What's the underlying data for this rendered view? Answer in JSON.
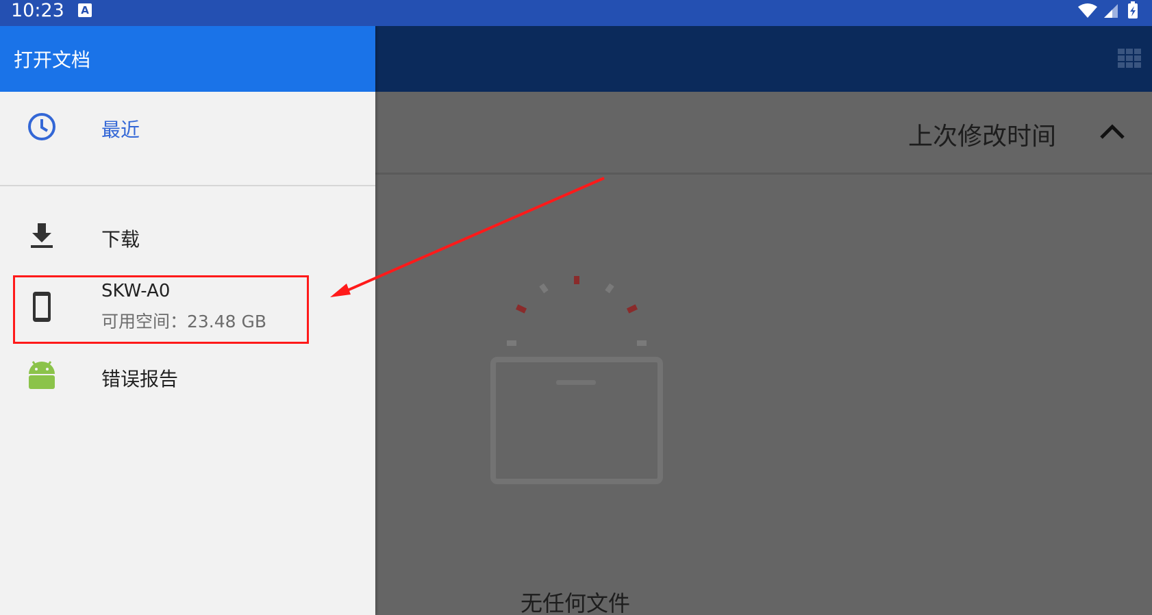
{
  "status_bar": {
    "time": "10:23",
    "notification_icon": "A",
    "icons": [
      "wifi-icon",
      "signal-icon",
      "battery-charging-icon"
    ]
  },
  "drawer": {
    "title": "打开文档",
    "items": [
      {
        "icon": "clock-icon",
        "label": "最近",
        "selected": true
      },
      {
        "icon": "download-icon",
        "label": "下载"
      },
      {
        "icon": "phone-icon",
        "label": "SKW-A0",
        "sublabel": "可用空间：23.48 GB"
      },
      {
        "icon": "android-icon",
        "label": "错误报告"
      }
    ]
  },
  "main": {
    "toolbar_icon": "grid-view-icon",
    "sort_label": "上次修改时间",
    "sort_icon": "chevron-up-icon",
    "empty_message": "无任何文件"
  },
  "colors": {
    "status_bar": "#2450b2",
    "drawer_header": "#1a73e8",
    "selected_item": "#3367d6",
    "annotation": "#ff1a1a"
  }
}
